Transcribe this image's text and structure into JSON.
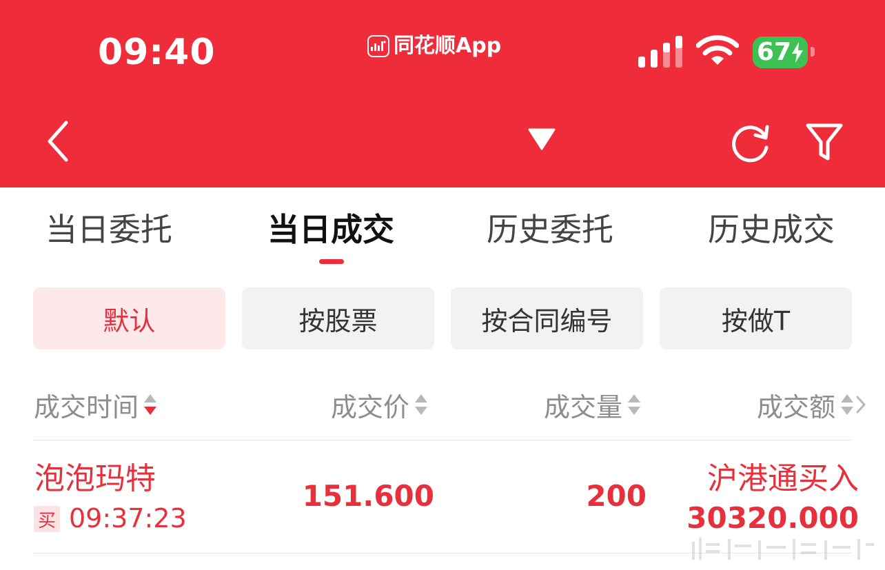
{
  "status_bar": {
    "time": "09:40",
    "app_name": "同花顺App",
    "battery": "67"
  },
  "nav": {
    "back_icon": "chevron-left-icon",
    "dropdown_icon": "caret-down-icon",
    "refresh_icon": "refresh-icon",
    "filter_icon": "filter-icon"
  },
  "tabs": [
    {
      "label": "当日委托",
      "active": false
    },
    {
      "label": "当日成交",
      "active": true
    },
    {
      "label": "历史委托",
      "active": false
    },
    {
      "label": "历史成交",
      "active": false
    }
  ],
  "filters": [
    {
      "label": "默认",
      "active": true
    },
    {
      "label": "按股票",
      "active": false
    },
    {
      "label": "按合同编号",
      "active": false
    },
    {
      "label": "按做T",
      "active": false
    }
  ],
  "columns": [
    {
      "label": "成交时间",
      "sort": "desc"
    },
    {
      "label": "成交价",
      "sort": "none"
    },
    {
      "label": "成交量",
      "sort": "none"
    },
    {
      "label": "成交额",
      "sort": "none"
    }
  ],
  "rows": [
    {
      "name": "泡泡玛特",
      "side": "买",
      "time": "09:37:23",
      "price": "151.600",
      "quantity": "200",
      "type": "沪港通买入",
      "amount": "30320.000"
    }
  ],
  "colors": {
    "brand_red": "#ef2d3a",
    "up_red": "#e8303c",
    "battery_green": "#3cc152"
  }
}
